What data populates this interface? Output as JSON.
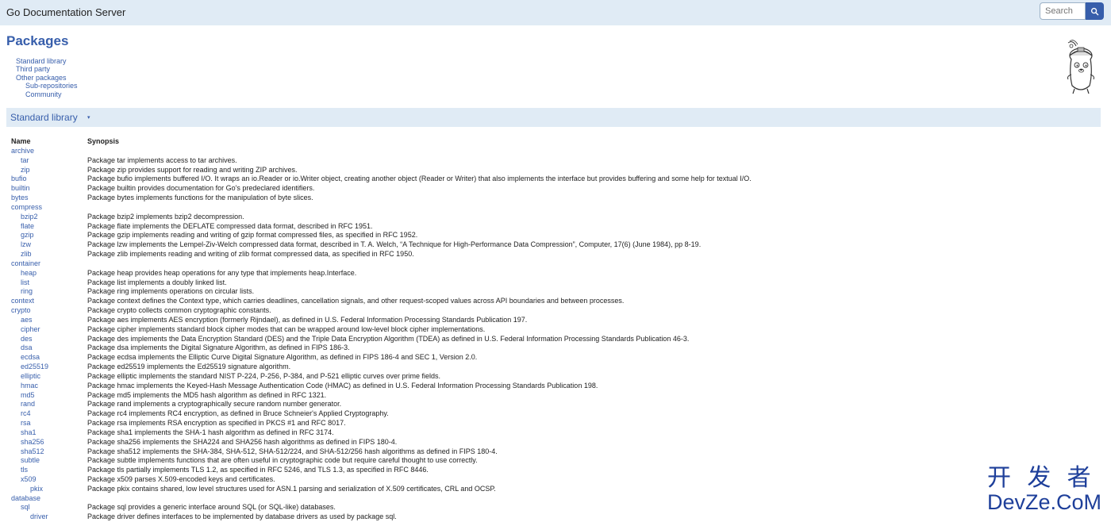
{
  "header": {
    "title": "Go Documentation Server",
    "search_placeholder": "Search"
  },
  "page_title": "Packages",
  "toc": [
    "Standard library",
    "Third party",
    "Other packages",
    "Sub-repositories",
    "Community"
  ],
  "section": {
    "title": "Standard library",
    "arrow": "▾"
  },
  "table": {
    "columns": [
      "Name",
      "Synopsis"
    ],
    "rows": [
      {
        "name": "archive",
        "level": 0,
        "synopsis": ""
      },
      {
        "name": "tar",
        "level": 1,
        "synopsis": "Package tar implements access to tar archives."
      },
      {
        "name": "zip",
        "level": 1,
        "synopsis": "Package zip provides support for reading and writing ZIP archives."
      },
      {
        "name": "bufio",
        "level": 0,
        "synopsis": "Package bufio implements buffered I/O. It wraps an io.Reader or io.Writer object, creating another object (Reader or Writer) that also implements the interface but provides buffering and some help for textual I/O."
      },
      {
        "name": "builtin",
        "level": 0,
        "synopsis": "Package builtin provides documentation for Go's predeclared identifiers."
      },
      {
        "name": "bytes",
        "level": 0,
        "synopsis": "Package bytes implements functions for the manipulation of byte slices."
      },
      {
        "name": "compress",
        "level": 0,
        "synopsis": ""
      },
      {
        "name": "bzip2",
        "level": 1,
        "synopsis": "Package bzip2 implements bzip2 decompression."
      },
      {
        "name": "flate",
        "level": 1,
        "synopsis": "Package flate implements the DEFLATE compressed data format, described in RFC 1951."
      },
      {
        "name": "gzip",
        "level": 1,
        "synopsis": "Package gzip implements reading and writing of gzip format compressed files, as specified in RFC 1952."
      },
      {
        "name": "lzw",
        "level": 1,
        "synopsis": "Package lzw implements the Lempel-Ziv-Welch compressed data format, described in T. A. Welch, “A Technique for High-Performance Data Compression”, Computer, 17(6) (June 1984), pp 8-19."
      },
      {
        "name": "zlib",
        "level": 1,
        "synopsis": "Package zlib implements reading and writing of zlib format compressed data, as specified in RFC 1950."
      },
      {
        "name": "container",
        "level": 0,
        "synopsis": ""
      },
      {
        "name": "heap",
        "level": 1,
        "synopsis": "Package heap provides heap operations for any type that implements heap.Interface."
      },
      {
        "name": "list",
        "level": 1,
        "synopsis": "Package list implements a doubly linked list."
      },
      {
        "name": "ring",
        "level": 1,
        "synopsis": "Package ring implements operations on circular lists."
      },
      {
        "name": "context",
        "level": 0,
        "synopsis": "Package context defines the Context type, which carries deadlines, cancellation signals, and other request-scoped values across API boundaries and between processes."
      },
      {
        "name": "crypto",
        "level": 0,
        "synopsis": "Package crypto collects common cryptographic constants."
      },
      {
        "name": "aes",
        "level": 1,
        "synopsis": "Package aes implements AES encryption (formerly Rijndael), as defined in U.S. Federal Information Processing Standards Publication 197."
      },
      {
        "name": "cipher",
        "level": 1,
        "synopsis": "Package cipher implements standard block cipher modes that can be wrapped around low-level block cipher implementations."
      },
      {
        "name": "des",
        "level": 1,
        "synopsis": "Package des implements the Data Encryption Standard (DES) and the Triple Data Encryption Algorithm (TDEA) as defined in U.S. Federal Information Processing Standards Publication 46-3."
      },
      {
        "name": "dsa",
        "level": 1,
        "synopsis": "Package dsa implements the Digital Signature Algorithm, as defined in FIPS 186-3."
      },
      {
        "name": "ecdsa",
        "level": 1,
        "synopsis": "Package ecdsa implements the Elliptic Curve Digital Signature Algorithm, as defined in FIPS 186-4 and SEC 1, Version 2.0."
      },
      {
        "name": "ed25519",
        "level": 1,
        "synopsis": "Package ed25519 implements the Ed25519 signature algorithm."
      },
      {
        "name": "elliptic",
        "level": 1,
        "synopsis": "Package elliptic implements the standard NIST P-224, P-256, P-384, and P-521 elliptic curves over prime fields."
      },
      {
        "name": "hmac",
        "level": 1,
        "synopsis": "Package hmac implements the Keyed-Hash Message Authentication Code (HMAC) as defined in U.S. Federal Information Processing Standards Publication 198."
      },
      {
        "name": "md5",
        "level": 1,
        "synopsis": "Package md5 implements the MD5 hash algorithm as defined in RFC 1321."
      },
      {
        "name": "rand",
        "level": 1,
        "synopsis": "Package rand implements a cryptographically secure random number generator."
      },
      {
        "name": "rc4",
        "level": 1,
        "synopsis": "Package rc4 implements RC4 encryption, as defined in Bruce Schneier's Applied Cryptography."
      },
      {
        "name": "rsa",
        "level": 1,
        "synopsis": "Package rsa implements RSA encryption as specified in PKCS #1 and RFC 8017."
      },
      {
        "name": "sha1",
        "level": 1,
        "synopsis": "Package sha1 implements the SHA-1 hash algorithm as defined in RFC 3174."
      },
      {
        "name": "sha256",
        "level": 1,
        "synopsis": "Package sha256 implements the SHA224 and SHA256 hash algorithms as defined in FIPS 180-4."
      },
      {
        "name": "sha512",
        "level": 1,
        "synopsis": "Package sha512 implements the SHA-384, SHA-512, SHA-512/224, and SHA-512/256 hash algorithms as defined in FIPS 180-4."
      },
      {
        "name": "subtle",
        "level": 1,
        "synopsis": "Package subtle implements functions that are often useful in cryptographic code but require careful thought to use correctly."
      },
      {
        "name": "tls",
        "level": 1,
        "synopsis": "Package tls partially implements TLS 1.2, as specified in RFC 5246, and TLS 1.3, as specified in RFC 8446."
      },
      {
        "name": "x509",
        "level": 1,
        "synopsis": "Package x509 parses X.509-encoded keys and certificates."
      },
      {
        "name": "pkix",
        "level": 2,
        "synopsis": "Package pkix contains shared, low level structures used for ASN.1 parsing and serialization of X.509 certificates, CRL and OCSP."
      },
      {
        "name": "database",
        "level": 0,
        "synopsis": ""
      },
      {
        "name": "sql",
        "level": 1,
        "synopsis": "Package sql provides a generic interface around SQL (or SQL-like) databases."
      },
      {
        "name": "driver",
        "level": 2,
        "synopsis": "Package driver defines interfaces to be implemented by database drivers as used by package sql."
      }
    ]
  },
  "watermark": {
    "line1": "开 发 者",
    "line2": "DevZe.CoM"
  },
  "colors": {
    "link": "#375eab",
    "bar": "#e0ebf5",
    "text": "#222222",
    "watermark": "#1e3f9a"
  }
}
